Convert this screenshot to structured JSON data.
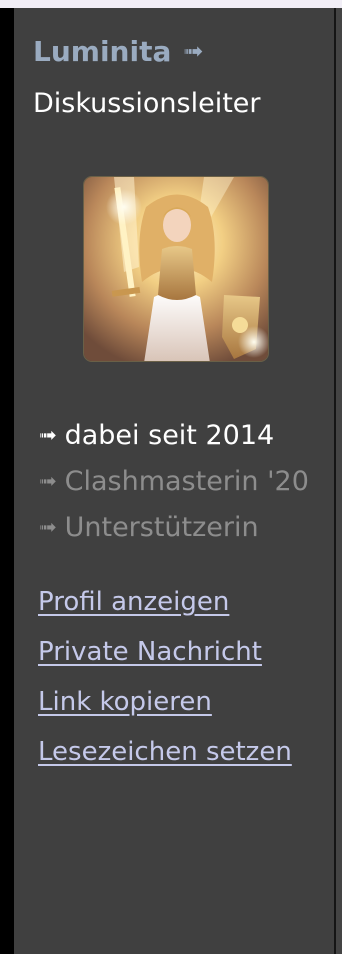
{
  "profile": {
    "username": "Luminita",
    "username_icon": "link-icon",
    "role": "Diskussionsleiter",
    "avatar_alt": "avatar"
  },
  "badges": [
    {
      "icon": "link-icon",
      "label": "dabei seit 2014",
      "state": "active"
    },
    {
      "icon": "link-icon",
      "label": "Clashmasterin '20",
      "state": "muted"
    },
    {
      "icon": "link-icon",
      "label": "Unterstützerin",
      "state": "muted"
    }
  ],
  "links": [
    {
      "label": "Profil anzeigen"
    },
    {
      "label": "Private Nachricht"
    },
    {
      "label": "Link kopieren"
    },
    {
      "label": "Lesezeichen setzen"
    }
  ],
  "colors": {
    "username": "#9aabc0",
    "panel_bg": "#404040",
    "link": "#c5c9ea",
    "muted": "#8d8d8d"
  }
}
